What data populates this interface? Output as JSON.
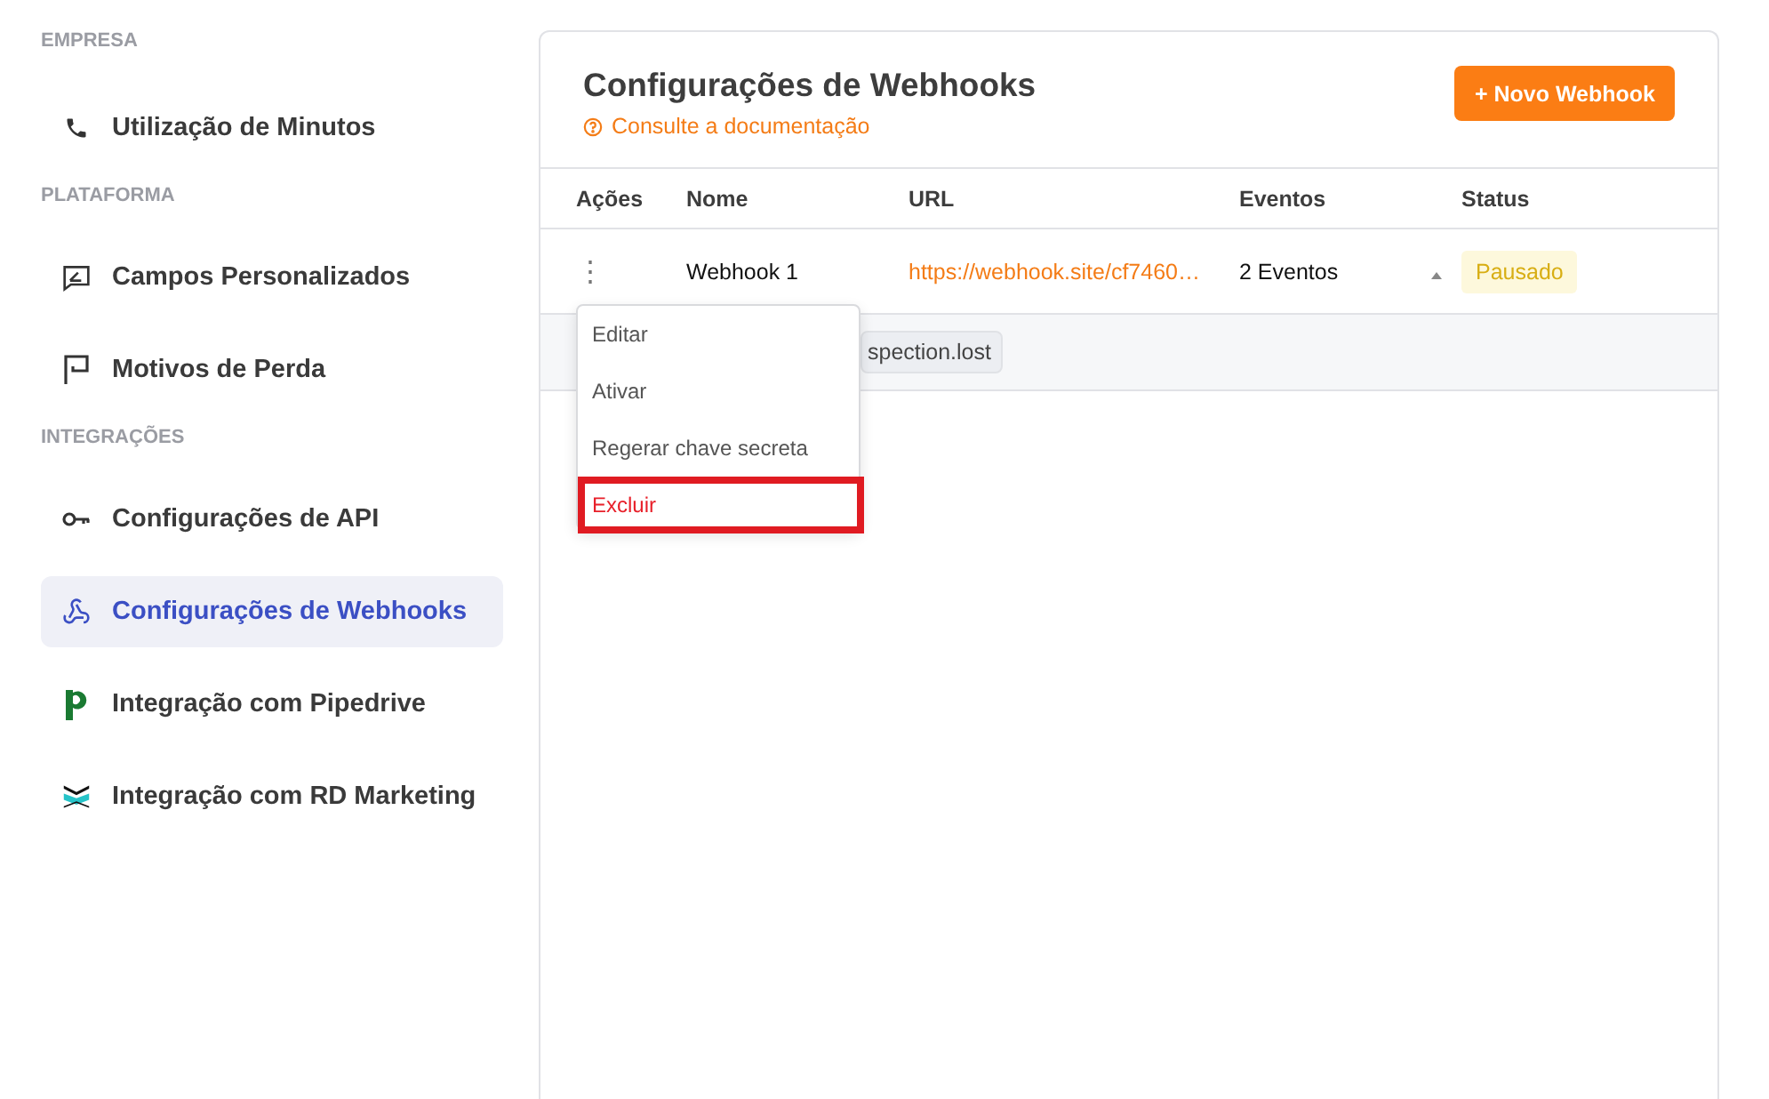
{
  "sidebar": {
    "sections": [
      {
        "title": "EMPRESA",
        "items": [
          {
            "label": "Utilização de Minutos",
            "kind": "phone",
            "selected": false
          }
        ]
      },
      {
        "title": "PLATAFORMA",
        "items": [
          {
            "label": "Campos Personalizados",
            "kind": "fields",
            "selected": false
          },
          {
            "label": "Motivos de Perda",
            "kind": "flag",
            "selected": false
          }
        ]
      },
      {
        "title": "INTEGRAÇÕES",
        "items": [
          {
            "label": "Configurações de API",
            "kind": "key",
            "selected": false
          },
          {
            "label": "Configurações de Webhooks",
            "kind": "webhook",
            "selected": true
          },
          {
            "label": "Integração com Pipedrive",
            "kind": "pipedrive",
            "selected": false
          },
          {
            "label": "Integração com RD Marketing",
            "kind": "rd",
            "selected": false
          }
        ]
      }
    ]
  },
  "main": {
    "title": "Configurações de Webhooks",
    "doc_link": "Consulte a documentação",
    "new_button": "+ Novo Webhook",
    "table": {
      "columns": [
        "Ações",
        "Nome",
        "URL",
        "Eventos",
        "Status"
      ],
      "rows": [
        {
          "actions": "⋮",
          "name": "Webhook 1",
          "url": "https://webhook.site/cf7460…",
          "events": "2 Eventos",
          "expanded": true,
          "status": "Pausado",
          "event_tags": [
            "spection.lost"
          ]
        }
      ]
    },
    "menu": {
      "items": [
        {
          "label": "Editar",
          "kind": "normal",
          "highlighted": false
        },
        {
          "label": "Ativar",
          "kind": "normal",
          "highlighted": false
        },
        {
          "label": "Regerar chave secreta",
          "kind": "normal",
          "highlighted": false
        },
        {
          "label": "Excluir",
          "kind": "danger",
          "highlighted": true
        }
      ]
    }
  }
}
